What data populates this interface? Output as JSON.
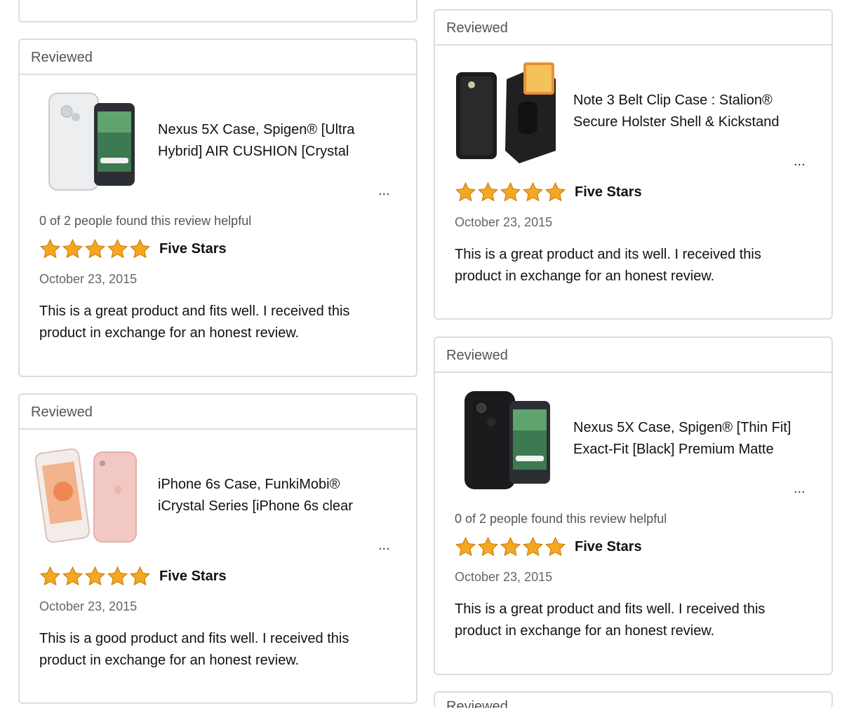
{
  "colors": {
    "star": "#f5a623",
    "star_stroke": "#c77800",
    "border": "#dcdcdc"
  },
  "cards": [
    {
      "header": "Reviewed",
      "product_title": "Nexus 5X Case, Spigen® [Ultra Hybrid] AIR CUSHION [Crystal",
      "ellipsis": "...",
      "helpful": "0 of 2 people found this review helpful",
      "rating": 5,
      "review_title": "Five Stars",
      "date": "October 23, 2015",
      "body": "This is a great product and fits well. I received this product in exchange for an honest review."
    },
    {
      "header": "Reviewed",
      "product_title": "iPhone 6s Case, FunkiMobi® iCrystal Series [iPhone 6s clear",
      "ellipsis": "...",
      "rating": 5,
      "review_title": "Five Stars",
      "date": "October 23, 2015",
      "body": "This is a good product and fits well. I received this product in exchange for an honest review."
    },
    {
      "header": "Reviewed",
      "product_title": "Note 3 Belt Clip Case : Stalion® Secure Holster Shell & Kickstand",
      "ellipsis": "...",
      "rating": 5,
      "review_title": "Five Stars",
      "date": "October 23, 2015",
      "body": "This is a great product and its well. I received this product in exchange for an honest review."
    },
    {
      "header": "Reviewed",
      "product_title": "Nexus 5X Case, Spigen® [Thin Fit] Exact-Fit [Black] Premium Matte",
      "ellipsis": "...",
      "helpful": "0 of 2 people found this review helpful",
      "rating": 5,
      "review_title": "Five Stars",
      "date": "October 23, 2015",
      "body": "This is a great product and fits well. I received this product in exchange for an honest review."
    },
    {
      "header": "Reviewed"
    }
  ]
}
